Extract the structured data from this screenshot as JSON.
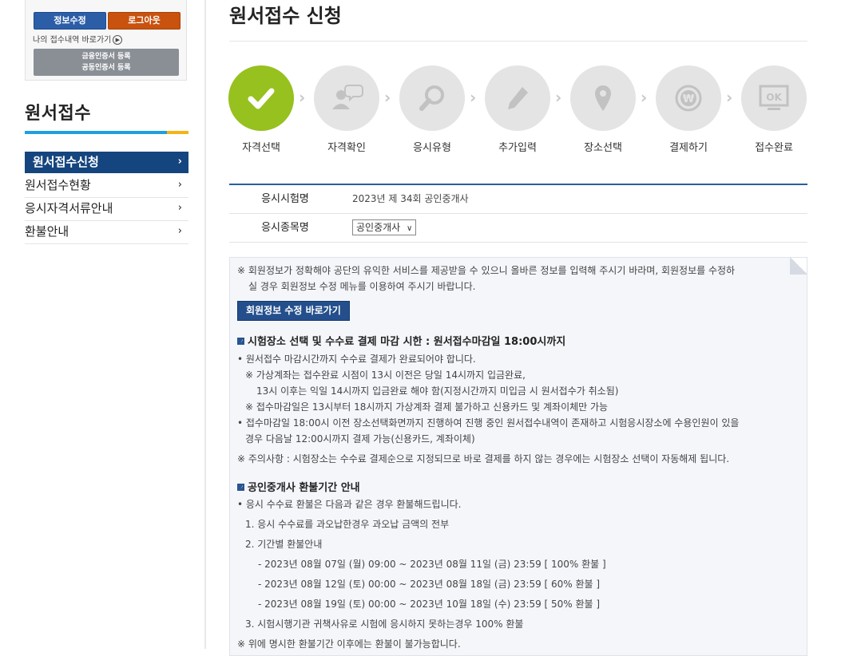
{
  "sidebar": {
    "edit_info": "정보수정",
    "logout": "로그아웃",
    "my_history": "나의 접수내역 바로가기",
    "cert_line1": "금융인증서 등록",
    "cert_line2": "공동인증서 등록",
    "title": "원서접수",
    "menu": [
      {
        "label": "원서접수신청"
      },
      {
        "label": "원서접수현황"
      },
      {
        "label": "응시자격서류안내"
      },
      {
        "label": "환불안내"
      }
    ]
  },
  "main": {
    "title": "원서접수 신청",
    "steps": [
      {
        "label": "자격선택",
        "icon": "check-icon",
        "done": true
      },
      {
        "label": "자격확인",
        "icon": "person-speech-icon"
      },
      {
        "label": "응시유형",
        "icon": "magnifier-icon"
      },
      {
        "label": "추가입력",
        "icon": "pencil-icon"
      },
      {
        "label": "장소선택",
        "icon": "location-pin-icon"
      },
      {
        "label": "결제하기",
        "icon": "won-coin-icon"
      },
      {
        "label": "접수완료",
        "icon": "ok-monitor-icon"
      }
    ],
    "exam_name_label": "응시시험명",
    "exam_name_value": "2023년 제 34회 공인중개사",
    "exam_subject_label": "응시종목명",
    "exam_subject_value": "공인중개사",
    "notice": {
      "intro1": "※ 회원정보가 정확해야 공단의 유익한 서비스를 제공받을 수 있으니 올바른 정보를 입력해 주시기 바라며, 회원정보를 수정하",
      "intro2": "실 경우 회원정보 수정 메뉴를 이용하여 주시기 바랍니다.",
      "edit_button": "회원정보 수정 바로가기",
      "section1_title": "시험장소 선택 및 수수료 결제 마감 시한 : 원서접수마감일 18:00시까지",
      "s1_l1": "• 원서접수 마감시간까지 수수료 결제가 완료되어야 합니다.",
      "s1_l2": "※ 가상계좌는 접수완료 시점이 13시 이전은 당일 14시까지 입금완료,",
      "s1_l3": "13시 이후는 익일 14시까지 입금완료 해야 함(지정시간까지 미입금 시 원서접수가 취소됨)",
      "s1_l4": "※ 접수마감일은 13시부터 18시까지 가상계좌 결제 불가하고 신용카드 및 계좌이체만 가능",
      "s1_l5": "• 접수마감일 18:00시 이전 장소선택화면까지 진행하여 진행 중인 원서접수내역이 존재하고 시험응시장소에 수용인원이 있을",
      "s1_l6": "경우 다음날 12:00시까지 결제 가능(신용카드, 계좌이체)",
      "s1_l7": "※ 주의사항 : 시험장소는 수수료 결제순으로 지정되므로 바로 결제를 하지 않는 경우에는 시험장소 선택이 자동해제 됩니다.",
      "section2_title": "공인중개사 환불기간 안내",
      "s2_l1": "• 응시 수수료 환불은 다음과 같은 경우 환불해드립니다.",
      "s2_l2": "1. 응시 수수료를 과오납한경우 과오납 금액의 전부",
      "s2_l3": "2. 기간별 환불안내",
      "s2_l4": "- 2023년 08월 07일 (월) 09:00 ~ 2023년 08월 11일 (금) 23:59   [ 100% 환불 ]",
      "s2_l5": "- 2023년 08월 12일 (토) 00:00 ~ 2023년 08월 18일 (금) 23:59   [ 60% 환불 ]",
      "s2_l6": "- 2023년 08월 19일 (토) 00:00 ~ 2023년 10월 18일 (수) 23:59   [ 50% 환불 ]",
      "s2_l7": "3. 시험시행기관 귀책사유로 시험에 응시하지 못하는경우 100% 환불",
      "s2_l8": "※ 위에 명시한 환불기간 이후에는 환불이 불가능합니다."
    }
  },
  "colors": {
    "accent_blue": "#15457e",
    "step_done": "#96c11e",
    "logout_orange": "#c8520e"
  }
}
